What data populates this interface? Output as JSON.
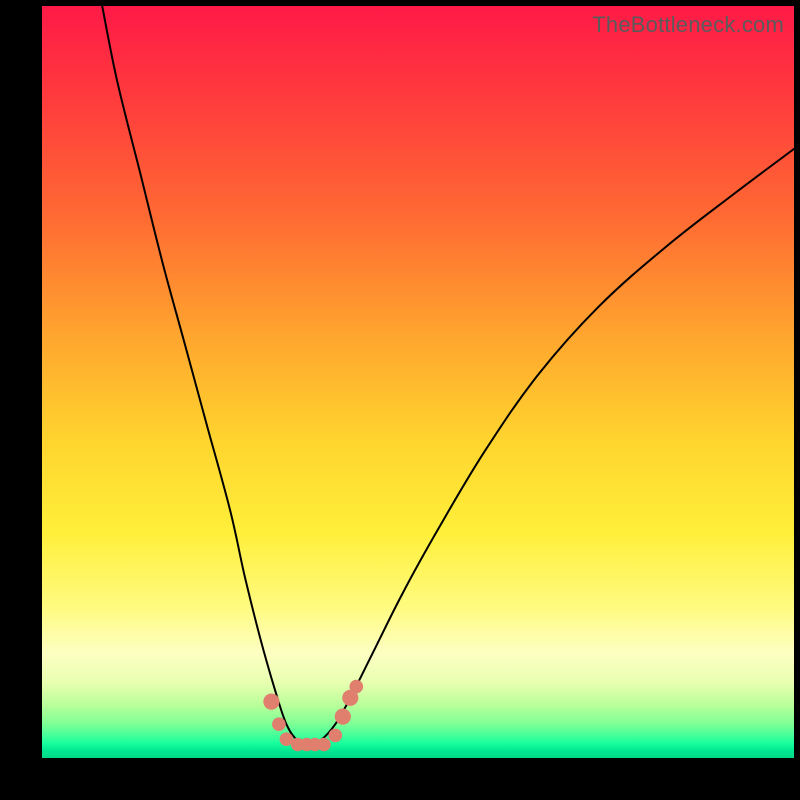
{
  "watermark": "TheBottleneck.com",
  "chart_data": {
    "type": "line",
    "title": "",
    "xlabel": "",
    "ylabel": "",
    "xlim": [
      0,
      100
    ],
    "ylim": [
      0,
      100
    ],
    "series": [
      {
        "name": "bottleneck-curve",
        "x": [
          8,
          10,
          13,
          16,
          19,
          22,
          25,
          27,
          29,
          31,
          32.5,
          34,
          35.5,
          37,
          39,
          41,
          44,
          48,
          53,
          59,
          66,
          74,
          83,
          92,
          100
        ],
        "values": [
          100,
          90,
          78,
          66,
          55,
          44,
          33,
          24,
          16,
          9,
          4.5,
          2.3,
          1.8,
          2.3,
          4.5,
          8,
          14,
          22,
          31,
          41,
          51,
          60,
          68,
          75,
          81
        ]
      }
    ],
    "markers": {
      "name": "highlight-points",
      "color": "#e07f6e",
      "points": [
        {
          "x": 30.5,
          "y": 7.5,
          "r": 1.2
        },
        {
          "x": 31.5,
          "y": 4.5,
          "r": 1.0
        },
        {
          "x": 32.5,
          "y": 2.5,
          "r": 1.0
        },
        {
          "x": 34.0,
          "y": 1.8,
          "r": 1.0
        },
        {
          "x": 35.2,
          "y": 1.8,
          "r": 1.0
        },
        {
          "x": 36.3,
          "y": 1.8,
          "r": 1.0
        },
        {
          "x": 37.5,
          "y": 1.8,
          "r": 1.0
        },
        {
          "x": 39.0,
          "y": 3.0,
          "r": 1.0
        },
        {
          "x": 40.0,
          "y": 5.5,
          "r": 1.2
        },
        {
          "x": 41.0,
          "y": 8.0,
          "r": 1.2
        },
        {
          "x": 41.8,
          "y": 9.5,
          "r": 1.0
        }
      ]
    }
  }
}
